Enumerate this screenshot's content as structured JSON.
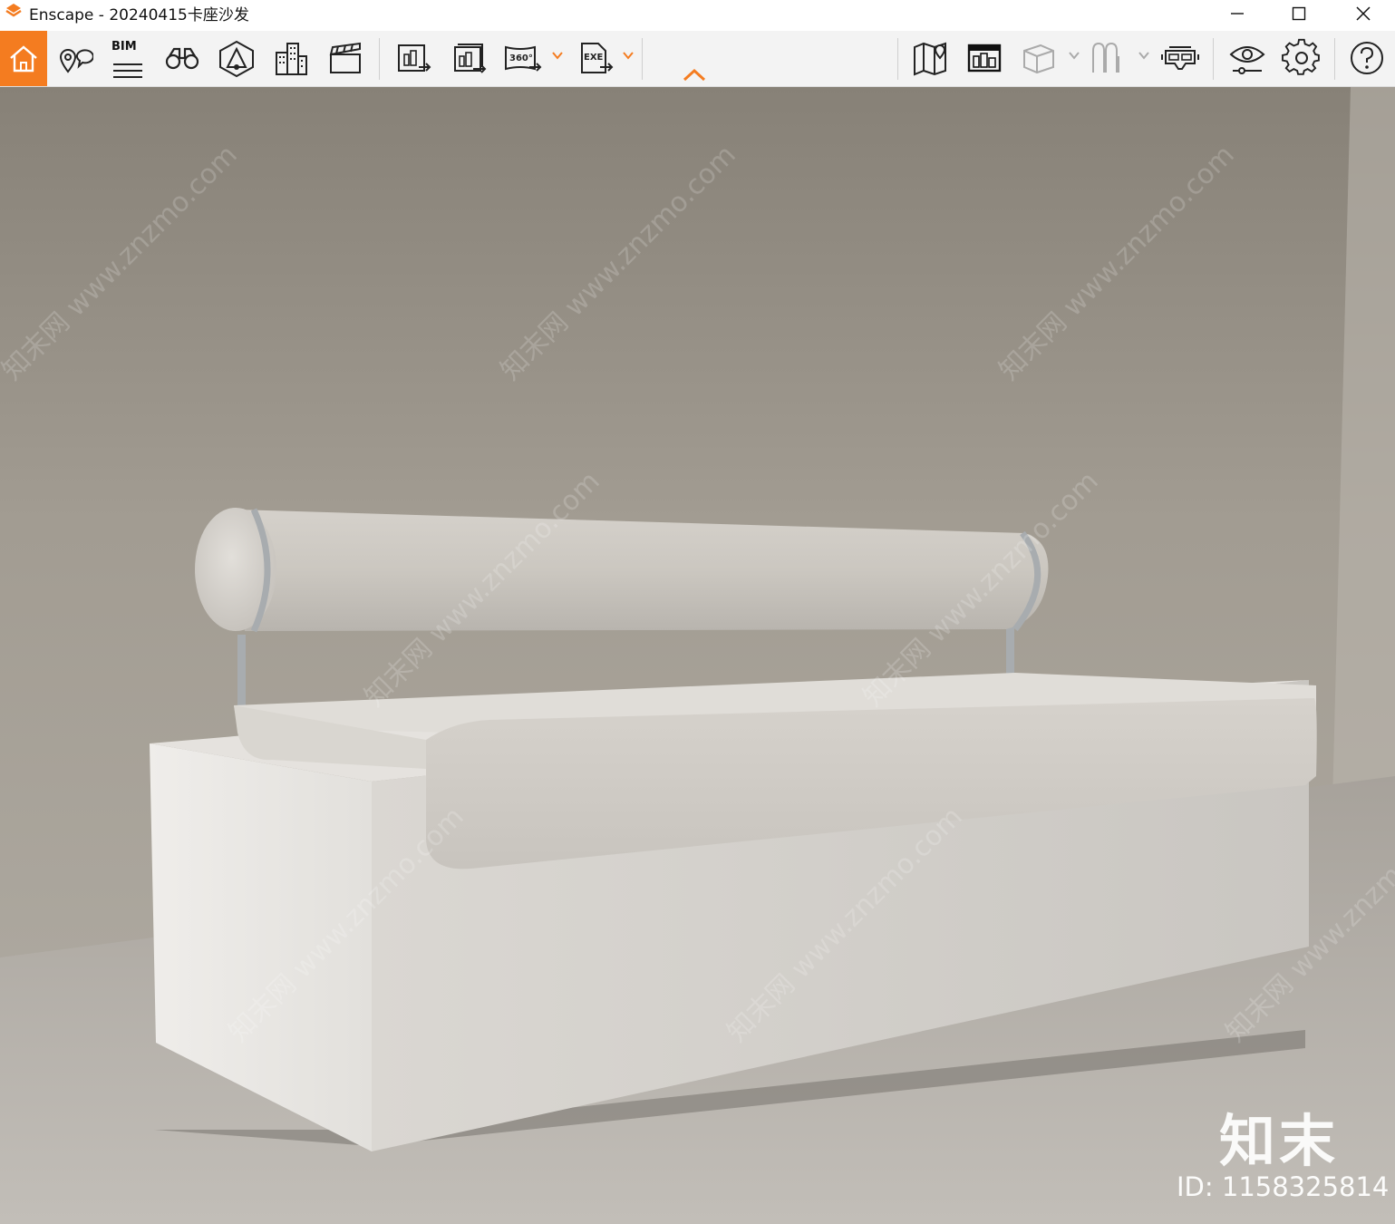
{
  "window": {
    "title": "Enscape - 20240415卡座沙发",
    "brand_color": "#f47c20"
  },
  "toolbar": {
    "bim_label": "BIM",
    "exe_label": "EXE",
    "pano_label": "360°",
    "icons": [
      "home-icon",
      "location-pin-icon",
      "bim-icon",
      "binoculars-icon",
      "perspective-icon",
      "buildings-icon",
      "clapper-icon",
      "batch-render-icon",
      "export-render-icon",
      "panorama-icon",
      "exe-export-icon",
      "collapse-icon",
      "map-icon",
      "asset-library-icon",
      "box-view-icon",
      "material-icon",
      "vr-headset-icon",
      "eye-settings-icon",
      "gear-icon",
      "help-icon"
    ]
  },
  "watermark": {
    "logo": "知末",
    "id": "ID: 1158325814",
    "diagonal": "知末网 www.znzmo.com"
  }
}
